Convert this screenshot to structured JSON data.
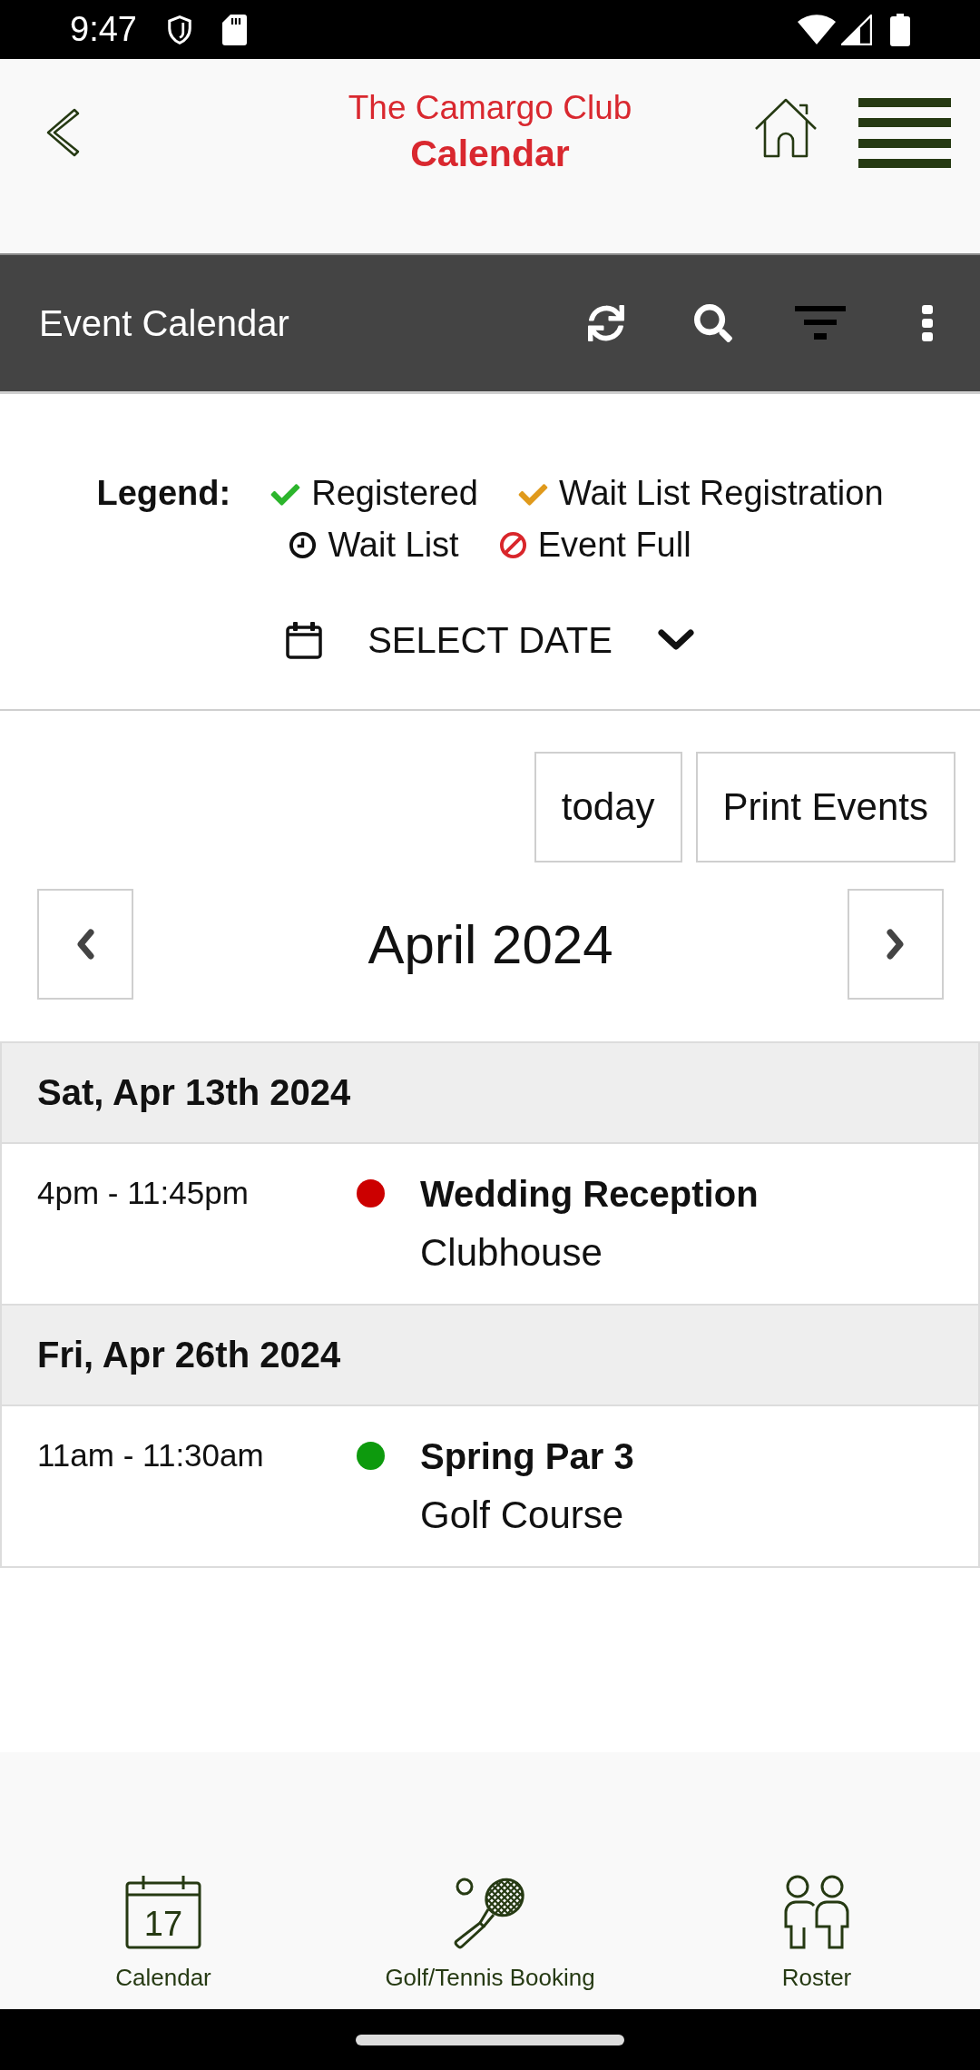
{
  "status_bar": {
    "time": "9:47"
  },
  "header": {
    "club_name": "The Camargo Club",
    "title": "Calendar"
  },
  "toolbar": {
    "title": "Event Calendar"
  },
  "legend": {
    "label": "Legend:",
    "items": [
      {
        "kind": "check",
        "label": "Registered",
        "color": "#2cb52c"
      },
      {
        "kind": "check",
        "label": "Wait List Registration",
        "color": "#e09a1c"
      },
      {
        "kind": "clock",
        "label": "Wait List",
        "color": "#111111"
      },
      {
        "kind": "ban",
        "label": "Event Full",
        "color": "#d9262b"
      }
    ]
  },
  "date_picker": {
    "label": "SELECT DATE"
  },
  "buttons": [
    "today",
    "Print Events"
  ],
  "month_nav": {
    "title": "April 2024"
  },
  "days": [
    {
      "date": "Sat, Apr 13th 2024",
      "events": [
        {
          "time": "4pm - 11:45pm",
          "title": "Wedding Reception",
          "location": "Clubhouse",
          "color": "#cc0000"
        }
      ]
    },
    {
      "date": "Fri, Apr 26th 2024",
      "events": [
        {
          "time": "11am - 11:30am",
          "title": "Spring Par 3",
          "location": "Golf Course",
          "color": "#0d9a0d"
        }
      ]
    }
  ],
  "bottom_nav": [
    {
      "kind": "calendar",
      "label": "Calendar",
      "icon_text": "17"
    },
    {
      "kind": "racket",
      "label": "Golf/Tennis Booking"
    },
    {
      "kind": "people",
      "label": "Roster"
    }
  ]
}
